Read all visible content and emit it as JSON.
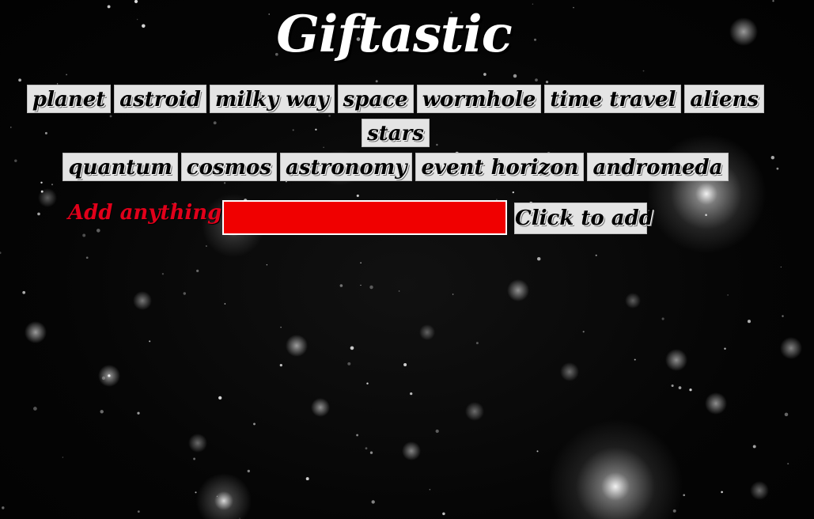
{
  "header": {
    "title": "Giftastic"
  },
  "topics": [
    "planet",
    "astroid",
    "milky way",
    "space",
    "wormhole",
    "time travel",
    "aliens",
    "stars",
    "quantum",
    "cosmos",
    "astronomy",
    "event horizon",
    "andromeda"
  ],
  "add_form": {
    "label": "Add anything:",
    "input_value": "",
    "input_placeholder": "",
    "button_label": "Click to add"
  },
  "colors": {
    "label_red": "#e0001a",
    "input_red": "#f00000",
    "button_gray": "#e4e4e4",
    "background": "#030303"
  }
}
